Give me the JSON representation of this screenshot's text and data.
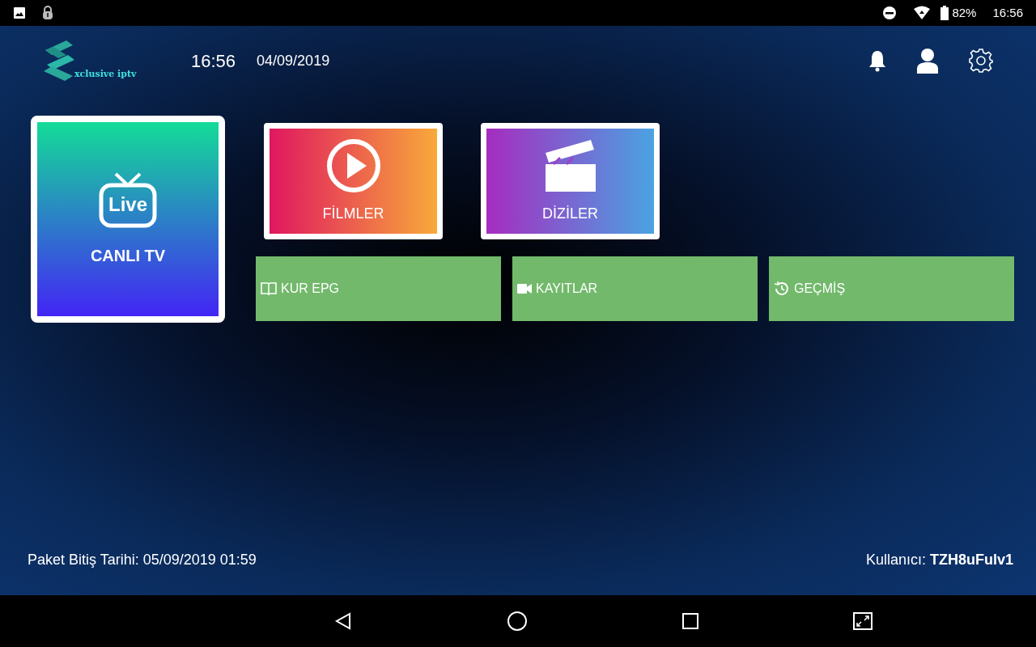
{
  "status_bar": {
    "battery": "82%",
    "time": "16:56"
  },
  "header": {
    "logo_text": "xclusive iptv",
    "time": "16:56",
    "date": "04/09/2019"
  },
  "tiles": [
    {
      "kind": "live",
      "label": "CANLI TV",
      "icon_text": "Live",
      "selected": true
    },
    {
      "kind": "movies",
      "label": "FİLMLER",
      "selected": false
    },
    {
      "kind": "series",
      "label": "DİZİLER",
      "selected": false
    }
  ],
  "actions": [
    {
      "kind": "epg",
      "label": "KUR EPG"
    },
    {
      "kind": "recordings",
      "label": "KAYITLAR"
    },
    {
      "kind": "history",
      "label": "GEÇMİŞ"
    }
  ],
  "footer": {
    "expiry": "Paket Bitiş Tarihi: 05/09/2019 01:59",
    "user": "Kullanıcı: **TZH8uFulv1**"
  }
}
